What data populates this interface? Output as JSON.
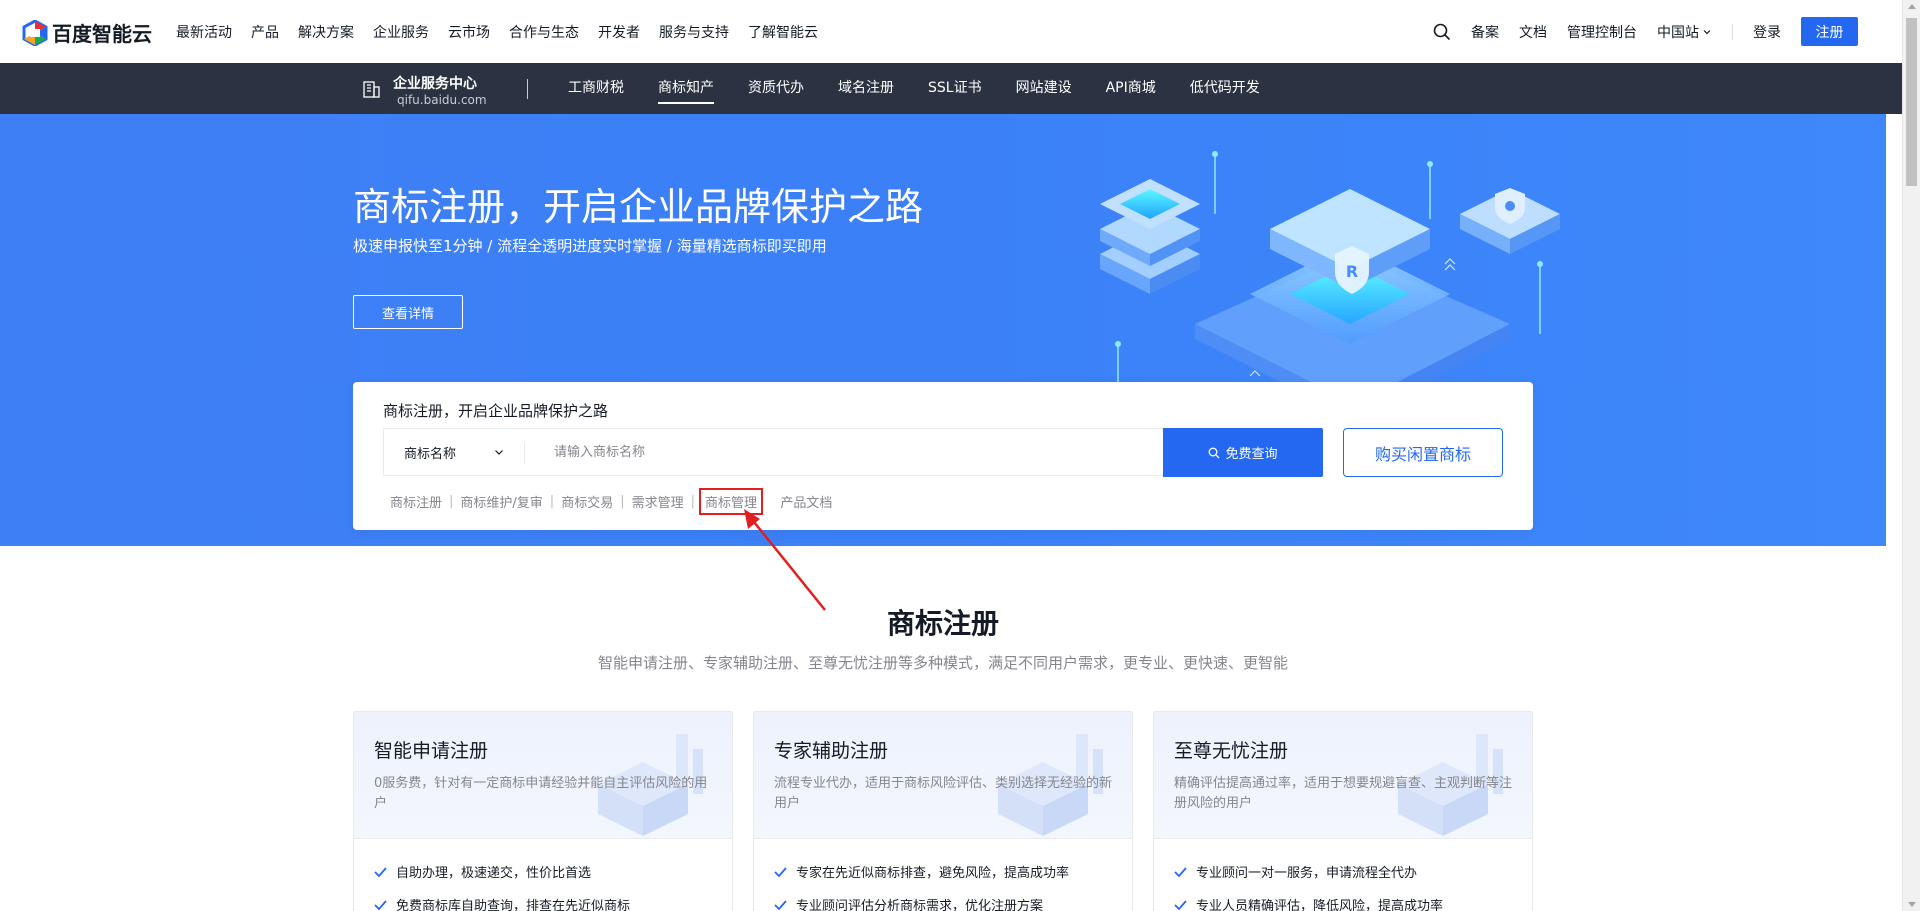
{
  "topnav": {
    "logo_text": "百度智能云",
    "items": [
      "最新活动",
      "产品",
      "解决方案",
      "企业服务",
      "云市场",
      "合作与生态",
      "开发者",
      "服务与支持",
      "了解智能云"
    ],
    "right": {
      "filing": "备案",
      "docs": "文档",
      "console": "管理控制台",
      "region": "中国站",
      "login": "登录",
      "register": "注册"
    }
  },
  "subnav": {
    "title": "企业服务中心",
    "domain": "qifu.baidu.com",
    "items": [
      "工商财税",
      "商标知产",
      "资质代办",
      "域名注册",
      "SSL证书",
      "网站建设",
      "API商城",
      "低代码开发"
    ],
    "active_index": 1
  },
  "hero": {
    "title": "商标注册，开启企业品牌保护之路",
    "subtitle": "极速申报快至1分钟 / 流程全透明进度实时掌握 / 海量精选商标即买即用",
    "detail_button": "查看详情"
  },
  "search": {
    "card_title": "商标注册，开启企业品牌保护之路",
    "type_selected": "商标名称",
    "placeholder": "请输入商标名称",
    "query_button": "免费查询",
    "buy_button": "购买闲置商标",
    "quick_links": [
      "商标注册",
      "商标维护/复审",
      "商标交易",
      "需求管理",
      "商标管理",
      "产品文档"
    ],
    "highlighted_link_index": 4
  },
  "section": {
    "title": "商标注册",
    "subtitle": "智能申请注册、专家辅助注册、至尊无忧注册等多种模式，满足不同用户需求，更专业、更快速、更智能"
  },
  "cards": [
    {
      "title": "智能申请注册",
      "desc": "0服务费，针对有一定商标申请经验并能自主评估风险的用户",
      "features": [
        "自助办理，极速递交，性价比首选",
        "免费商标库自助查询，排查在先近似商标"
      ]
    },
    {
      "title": "专家辅助注册",
      "desc": "流程专业代办，适用于商标风险评估、类别选择无经验的新用户",
      "features": [
        "专家在先近似商标排查，避免风险，提高成功率",
        "专业顾问评估分析商标需求，优化注册方案"
      ]
    },
    {
      "title": "至尊无忧注册",
      "desc": "精确评估提高通过率，适用于想要规避盲查、主观判断等注册风险的用户",
      "features": [
        "专业顾问一对一服务，申请流程全代办",
        "专业人员精确评估，降低风险，提高成功率"
      ]
    }
  ],
  "colors": {
    "brand": "#2468f2",
    "subnav_bg": "#2b3242",
    "hero_bg": "#3b80f7",
    "annotation_red": "#e02020"
  }
}
